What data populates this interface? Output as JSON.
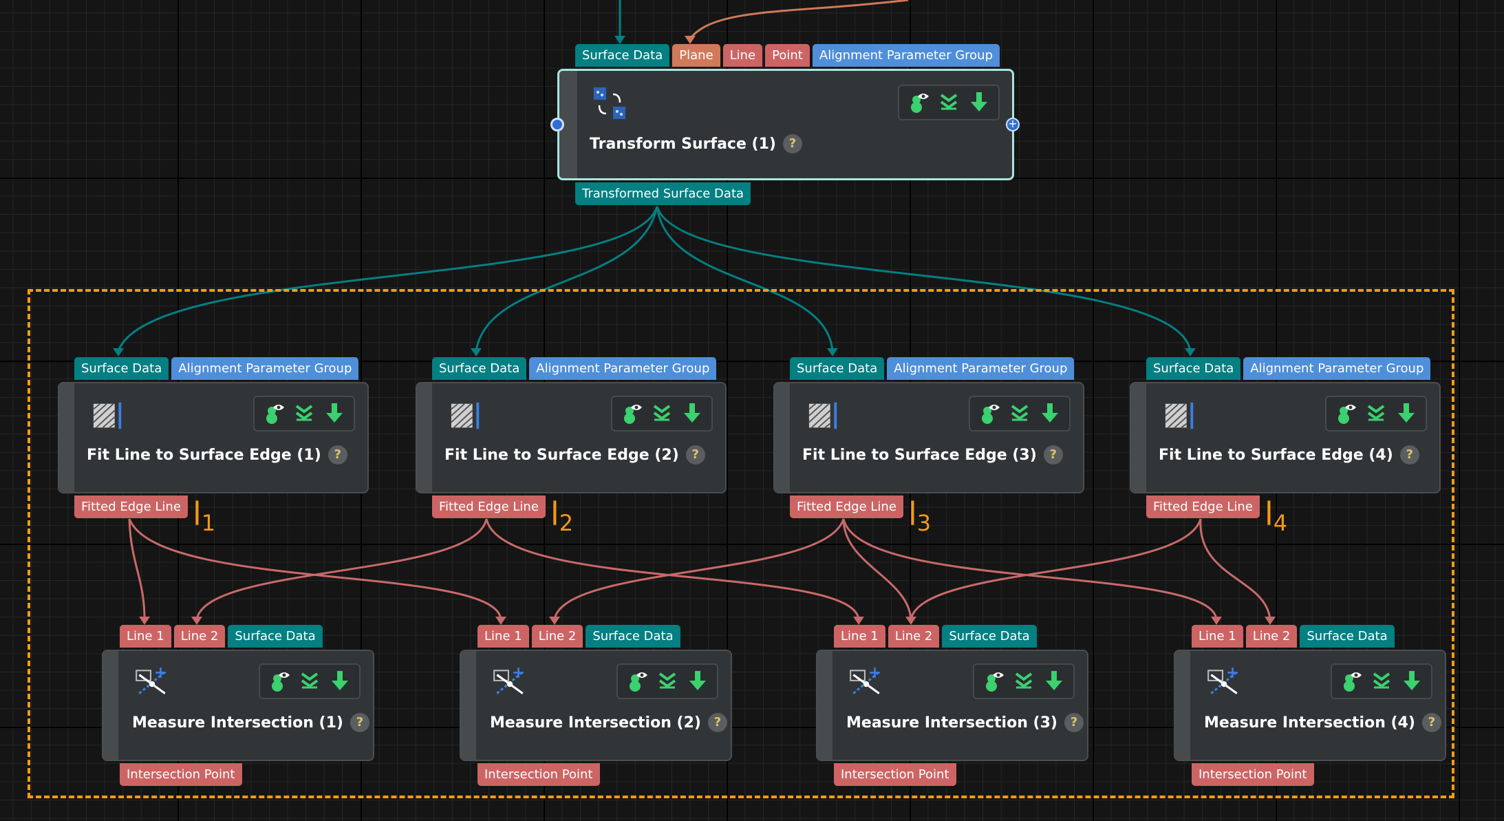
{
  "colors": {
    "data_wire": "#047f82",
    "line_wire": "#c96a6a",
    "input_orange_wire": "#cf7a5a",
    "group_border": "#f39a17",
    "label": "#f39a17"
  },
  "transform_node": {
    "title": "Transform Surface (1)",
    "help": "?",
    "inputs": [
      "Surface Data",
      "Plane",
      "Line",
      "Point",
      "Alignment Parameter Group"
    ],
    "output": "Transformed Surface Data",
    "icon": "transform-surface-icon",
    "tool_icons": [
      "visibility-icon",
      "expand-icon",
      "download-icon"
    ]
  },
  "fit_nodes": [
    {
      "title": "Fit Line to Surface Edge (1)",
      "inputs": [
        "Surface Data",
        "Alignment Parameter Group"
      ],
      "output": "Fitted Edge Line",
      "label": "l",
      "label_sub": "1"
    },
    {
      "title": "Fit Line to Surface Edge (2)",
      "inputs": [
        "Surface Data",
        "Alignment Parameter Group"
      ],
      "output": "Fitted Edge Line",
      "label": "l",
      "label_sub": "2"
    },
    {
      "title": "Fit Line to Surface Edge (3)",
      "inputs": [
        "Surface Data",
        "Alignment Parameter Group"
      ],
      "output": "Fitted Edge Line",
      "label": "l",
      "label_sub": "3"
    },
    {
      "title": "Fit Line to Surface Edge (4)",
      "inputs": [
        "Surface Data",
        "Alignment Parameter Group"
      ],
      "output": "Fitted Edge Line",
      "label": "l",
      "label_sub": "4"
    }
  ],
  "measure_nodes": [
    {
      "title": "Measure Intersection (1)",
      "inputs": [
        "Line 1",
        "Line 2",
        "Surface Data"
      ],
      "output": "Intersection Point"
    },
    {
      "title": "Measure Intersection (2)",
      "inputs": [
        "Line 1",
        "Line 2",
        "Surface Data"
      ],
      "output": "Intersection Point"
    },
    {
      "title": "Measure Intersection (3)",
      "inputs": [
        "Line 1",
        "Line 2",
        "Surface Data"
      ],
      "output": "Intersection Point"
    },
    {
      "title": "Measure Intersection (4)",
      "inputs": [
        "Line 1",
        "Line 2",
        "Surface Data"
      ],
      "output": "Intersection Point"
    }
  ],
  "help_symbol": "?"
}
